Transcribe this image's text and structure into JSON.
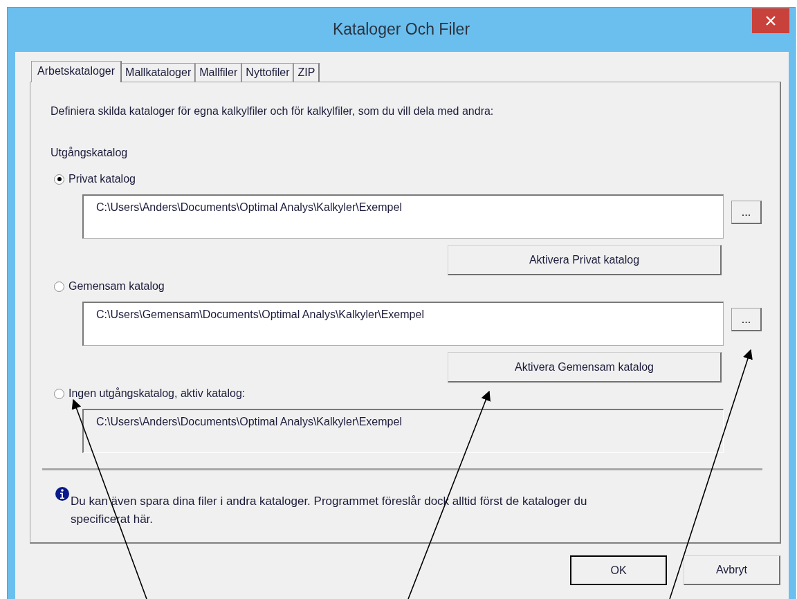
{
  "window": {
    "title": "Kataloger Och Filer"
  },
  "tabs": [
    {
      "label": "Arbetskataloger",
      "selected": true
    },
    {
      "label": "Mallkataloger",
      "selected": false
    },
    {
      "label": "Mallfiler",
      "selected": false
    },
    {
      "label": "Nyttofiler",
      "selected": false
    },
    {
      "label": "ZIP",
      "selected": false
    }
  ],
  "intro": "Definiera skilda kataloger för egna kalkylfiler och för kalkylfiler, som du vill dela med andra:",
  "group_label": "Utgångskatalog",
  "options": [
    {
      "kind": "editable",
      "label": "Privat katalog",
      "selected": true,
      "path": "C:\\Users\\Anders\\Documents\\Optimal Analys\\Kalkyler\\Exempel",
      "browse": "...",
      "activate": "Aktivera Privat katalog"
    },
    {
      "kind": "editable",
      "label": "Gemensam katalog",
      "selected": false,
      "path": "C:\\Users\\Gemensam\\Documents\\Optimal Analys\\Kalkyler\\Exempel",
      "browse": "...",
      "activate": "Aktivera Gemensam katalog"
    },
    {
      "kind": "readonly",
      "label": "Ingen utgångskatalog, aktiv katalog:",
      "selected": false,
      "path": "C:\\Users\\Anders\\Documents\\Optimal Analys\\Kalkyler\\Exempel"
    }
  ],
  "info": "Du kan även spara dina filer i andra kataloger. Programmet föreslår dock alltid först de kataloger du specificerat här.",
  "buttons": [
    {
      "label": "OK",
      "default": true
    },
    {
      "label": "Avbryt",
      "default": false
    }
  ]
}
